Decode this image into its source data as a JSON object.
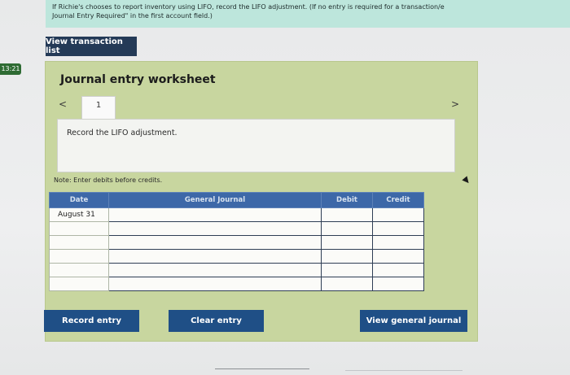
{
  "instructions": {
    "line1": "If Richie's chooses to report inventory using LIFO, record the LIFO adjustment. (If no entry is required for a transaction/e",
    "line2": "Journal Entry Required\" in the first account field.)"
  },
  "side_tag": "13:21",
  "buttons": {
    "view_transaction_list": "View transaction list",
    "record_entry": "Record entry",
    "clear_entry": "Clear entry",
    "view_general_journal": "View general journal"
  },
  "worksheet": {
    "title": "Journal entry worksheet",
    "prev_arrow": "<",
    "next_arrow": ">",
    "tab_number": "1",
    "description": "Record the LIFO adjustment.",
    "note": "Note: Enter debits before credits."
  },
  "table": {
    "headers": [
      "Date",
      "General Journal",
      "Debit",
      "Credit"
    ],
    "rows": [
      {
        "date": "August 31",
        "account": "",
        "debit": "",
        "credit": ""
      },
      {
        "date": "",
        "account": "",
        "debit": "",
        "credit": ""
      },
      {
        "date": "",
        "account": "",
        "debit": "",
        "credit": ""
      },
      {
        "date": "",
        "account": "",
        "debit": "",
        "credit": ""
      },
      {
        "date": "",
        "account": "",
        "debit": "",
        "credit": ""
      },
      {
        "date": "",
        "account": "",
        "debit": "",
        "credit": ""
      }
    ]
  }
}
